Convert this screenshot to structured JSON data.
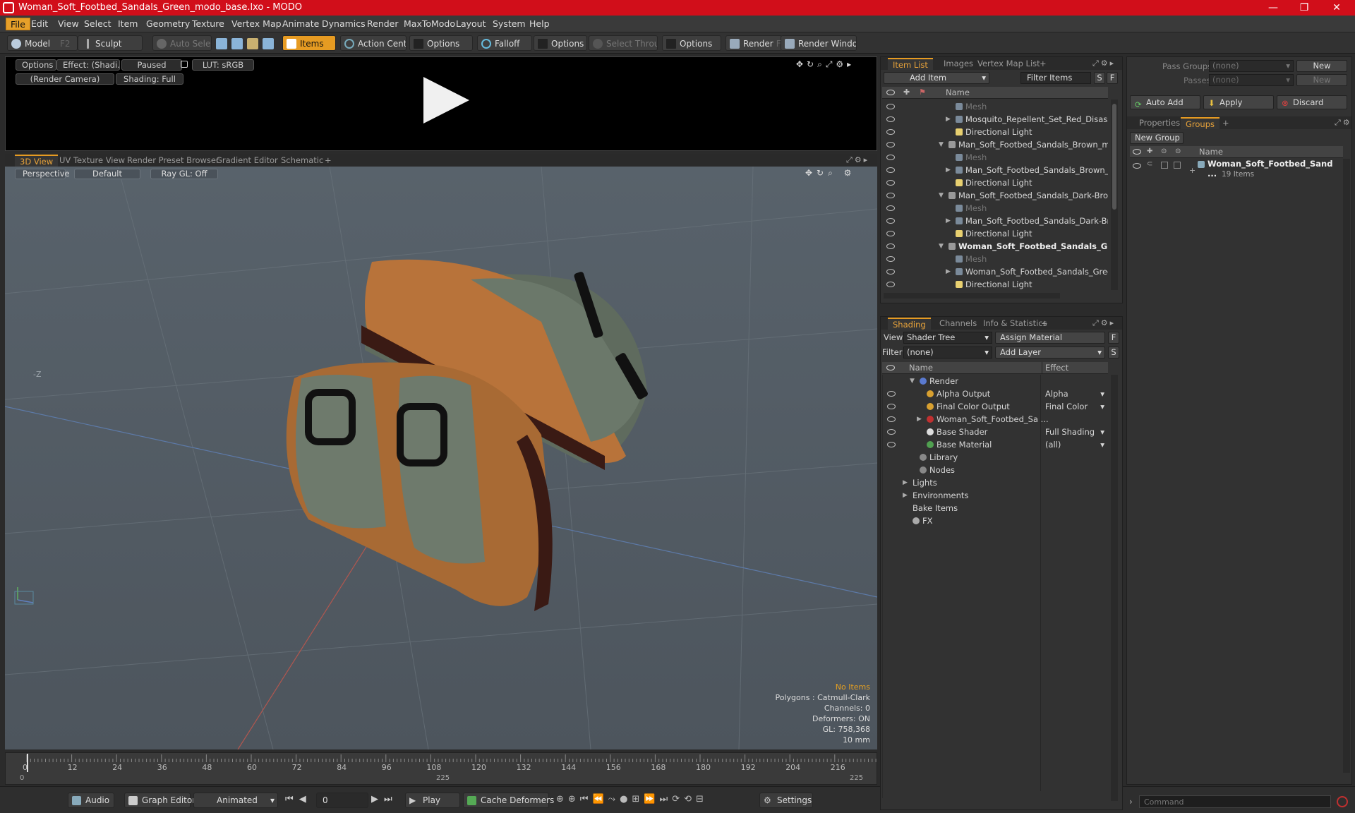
{
  "title": "Woman_Soft_Footbed_Sandals_Green_modo_base.lxo - MODO",
  "window_controls": {
    "minimize": "—",
    "maximize": "❐",
    "close": "✕"
  },
  "menu": [
    "File",
    "Edit",
    "View",
    "Select",
    "Item",
    "Geometry",
    "Texture",
    "Vertex Map",
    "Animate",
    "Dynamics",
    "Render",
    "MaxToModo",
    "Layout",
    "System",
    "Help"
  ],
  "toolbar": {
    "model": "Model",
    "model_key": "F2",
    "sculpt": "Sculpt",
    "auto_select": "Auto Select",
    "items": "Items",
    "action_center": "Action Center",
    "options1": "Options",
    "falloff": "Falloff",
    "options2": "Options",
    "select_through": "Select Through",
    "options3": "Options",
    "render": "Render",
    "render_key": "F9",
    "render_window": "Render Window"
  },
  "preview": {
    "options": "Options",
    "effect": "Effect: (Shadi...",
    "paused": "Paused",
    "lut": "LUT: sRGB",
    "camera": "(Render Camera)",
    "shading": "Shading: Full"
  },
  "viewport_tabs": [
    "3D View",
    "UV Texture View",
    "Render Preset Browser",
    "Gradient Editor",
    "Schematic",
    "+"
  ],
  "viewport": {
    "perspective": "Perspective",
    "default": "Default",
    "raygl": "Ray GL: Off",
    "axis_label": "-Z",
    "stats": {
      "no_items": "No Items",
      "polygons": "Polygons : Catmull-Clark",
      "channels": "Channels: 0",
      "deformers": "Deformers: ON",
      "gl": "GL: 758,368",
      "scale": "10 mm"
    }
  },
  "timeline": {
    "ticks": [
      "0",
      "12",
      "24",
      "36",
      "48",
      "60",
      "72",
      "84",
      "96",
      "108",
      "120",
      "132",
      "144",
      "156",
      "168",
      "180",
      "192",
      "204",
      "216"
    ],
    "start": "0",
    "mid": "225",
    "end": "225"
  },
  "bottombar": {
    "audio": "Audio",
    "graph_editor": "Graph Editor",
    "animated": "Animated",
    "frame": "0",
    "play": "Play",
    "cache": "Cache Deformers",
    "settings": "Settings"
  },
  "itemlist": {
    "tabs": [
      "Item List",
      "Images",
      "Vertex Map List",
      "+"
    ],
    "add_item": "Add Item",
    "filter": "Filter Items",
    "s": "S",
    "f": "F",
    "col_name": "Name",
    "rows": [
      {
        "label": "Mesh",
        "indent": 2,
        "type": "mesh"
      },
      {
        "label": "Mosquito_Repellent_Set_Red_Disasse...",
        "indent": 2,
        "type": "group",
        "arrow": "▶"
      },
      {
        "label": "Directional Light",
        "indent": 2,
        "type": "light"
      },
      {
        "label": "Man_Soft_Footbed_Sandals_Brown_mo ...",
        "indent": 1,
        "type": "scene",
        "arrow": "▼"
      },
      {
        "label": "Mesh",
        "indent": 2,
        "type": "mesh"
      },
      {
        "label": "Man_Soft_Footbed_Sandals_Brown_ ...",
        "indent": 2,
        "type": "group",
        "arrow": "▶"
      },
      {
        "label": "Directional Light",
        "indent": 2,
        "type": "light"
      },
      {
        "label": "Man_Soft_Footbed_Sandals_Dark-Brow ...",
        "indent": 1,
        "type": "scene",
        "arrow": "▼"
      },
      {
        "label": "Mesh",
        "indent": 2,
        "type": "mesh"
      },
      {
        "label": "Man_Soft_Footbed_Sandals_Dark-Bro...",
        "indent": 2,
        "type": "group",
        "arrow": "▶"
      },
      {
        "label": "Directional Light",
        "indent": 2,
        "type": "light"
      },
      {
        "label": "Woman_Soft_Footbed_Sandals_G ...",
        "indent": 1,
        "type": "scene",
        "arrow": "▼",
        "bold": true
      },
      {
        "label": "Mesh",
        "indent": 2,
        "type": "mesh"
      },
      {
        "label": "Woman_Soft_Footbed_Sandals_Gree ...",
        "indent": 2,
        "type": "group",
        "arrow": "▶"
      },
      {
        "label": "Directional Light",
        "indent": 2,
        "type": "light"
      }
    ]
  },
  "shading": {
    "tabs": [
      "Shading",
      "Channels",
      "Info & Statistics",
      "+"
    ],
    "view_label": "View",
    "view_value": "Shader Tree",
    "assign": "Assign Material",
    "f": "F",
    "filter_label": "Filter",
    "filter_value": "(none)",
    "add_layer": "Add Layer",
    "s": "S",
    "col_name": "Name",
    "col_effect": "Effect",
    "rows": [
      {
        "label": "Render",
        "effect": "",
        "indent": 1,
        "arrow": "▼",
        "color": "#5a7ad0",
        "eye": false
      },
      {
        "label": "Alpha Output",
        "effect": "Alpha",
        "indent": 2,
        "color": "#d8a030",
        "eye": true
      },
      {
        "label": "Final Color Output",
        "effect": "Final Color",
        "indent": 2,
        "color": "#d8a030",
        "eye": true
      },
      {
        "label": "Woman_Soft_Footbed_Sa ...",
        "effect": "",
        "indent": 2,
        "arrow": "▶",
        "color": "#c03030",
        "eye": true
      },
      {
        "label": "Base Shader",
        "effect": "Full Shading",
        "indent": 2,
        "color": "#dddddd",
        "eye": true
      },
      {
        "label": "Base Material",
        "effect": "(all)",
        "indent": 2,
        "color": "#50a050",
        "eye": true
      },
      {
        "label": "Library",
        "effect": "",
        "indent": 1,
        "color": "#888888",
        "eye": false
      },
      {
        "label": "Nodes",
        "effect": "",
        "indent": 1,
        "color": "#888888",
        "eye": false
      },
      {
        "label": "Lights",
        "effect": "",
        "indent": 0,
        "arrow": "▶",
        "eye": false
      },
      {
        "label": "Environments",
        "effect": "",
        "indent": 0,
        "arrow": "▶",
        "eye": false
      },
      {
        "label": "Bake Items",
        "effect": "",
        "indent": 0,
        "eye": false
      },
      {
        "label": "FX",
        "effect": "",
        "indent": 0,
        "color": "#aaaaaa",
        "eye": false
      }
    ]
  },
  "passes": {
    "pass_groups": "Pass Groups",
    "passes": "Passes",
    "none1": "(none)",
    "none2": "(none)",
    "new1": "New",
    "new2": "New",
    "auto_add": "Auto Add",
    "apply": "Apply",
    "discard": "Discard"
  },
  "groups": {
    "tabs": [
      "Properties",
      "Groups",
      "+"
    ],
    "new_group": "New Group",
    "col_name": "Name",
    "item": "Woman_Soft_Footbed_Sand ...",
    "count": "19 Items"
  },
  "command": {
    "placeholder": "Command"
  }
}
